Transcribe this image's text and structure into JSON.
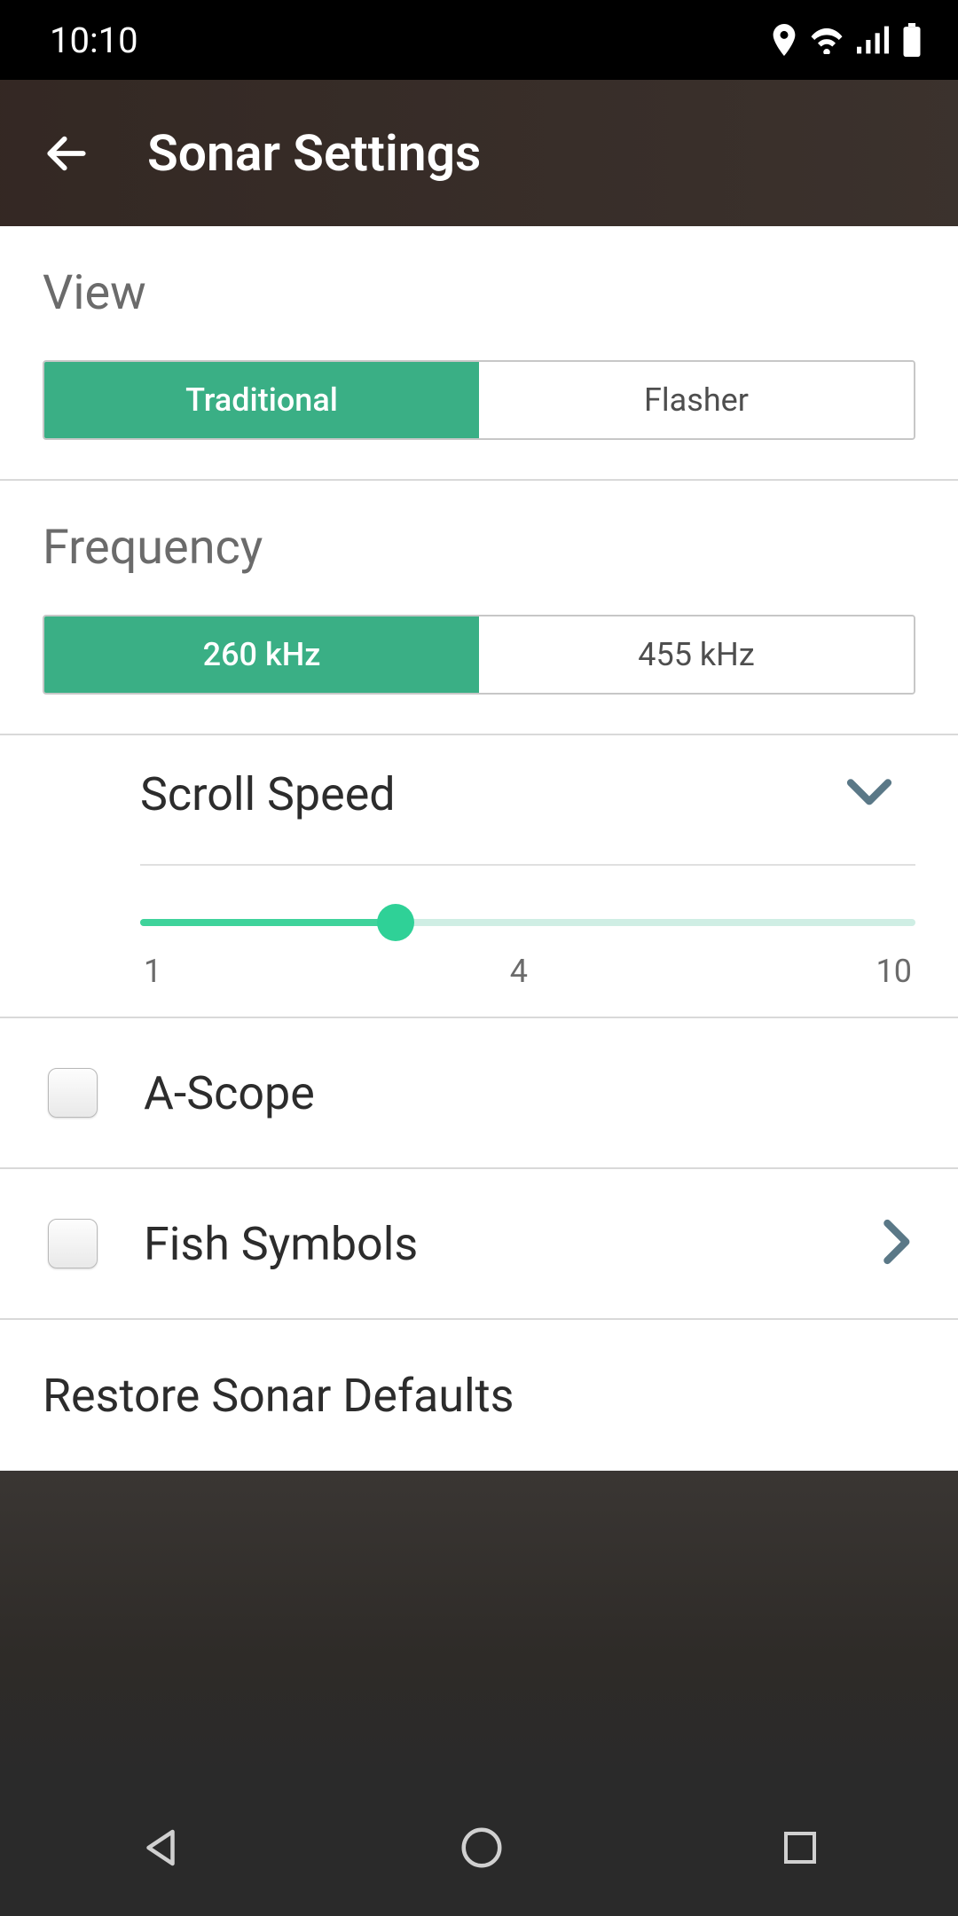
{
  "status": {
    "time": "10:10"
  },
  "header": {
    "title": "Sonar Settings"
  },
  "view": {
    "label": "View",
    "options": [
      "Traditional",
      "Flasher"
    ],
    "selected": 0
  },
  "frequency": {
    "label": "Frequency",
    "options": [
      "260 kHz",
      "455 kHz"
    ],
    "selected": 0
  },
  "scroll_speed": {
    "label": "Scroll Speed",
    "min": 1,
    "mid": 4,
    "max": 10,
    "value": 4,
    "percent": 33
  },
  "a_scope": {
    "label": "A-Scope",
    "checked": false
  },
  "fish_symbols": {
    "label": "Fish Symbols",
    "checked": false
  },
  "restore": {
    "label": "Restore Sonar Defaults"
  },
  "colors": {
    "accent": "#3aaf85"
  }
}
